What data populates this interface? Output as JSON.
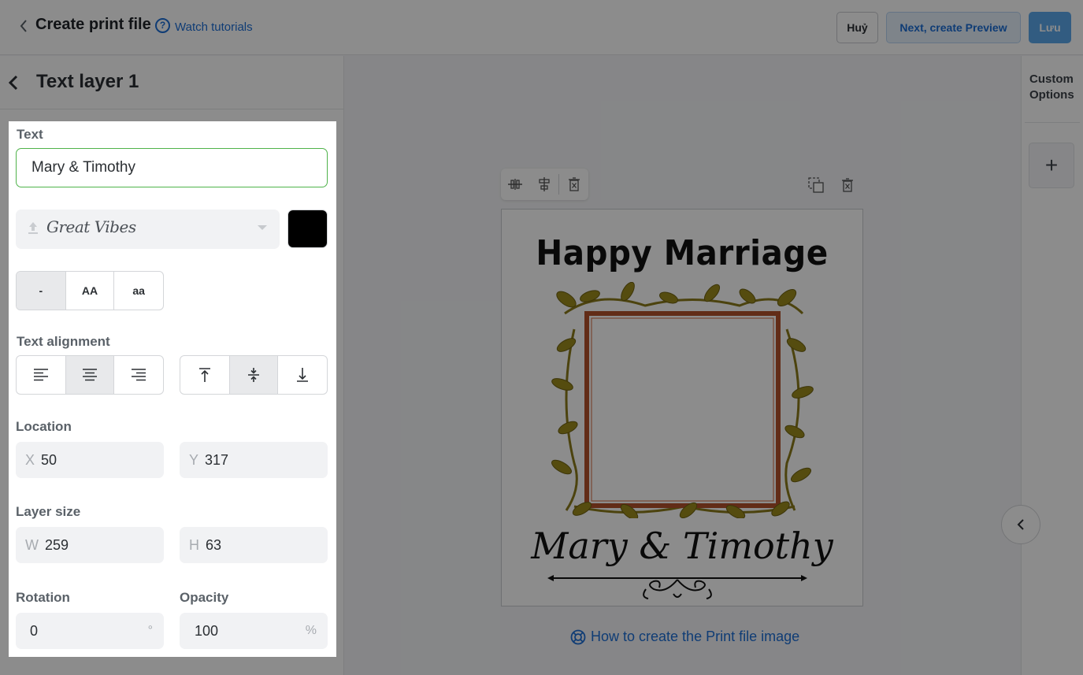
{
  "header": {
    "title": "Create print file",
    "tutorials_link": "Watch tutorials",
    "help_glyph": "?",
    "cancel_label": "Huỷ",
    "next_label": "Next, create Preview",
    "save_label": "Lưu"
  },
  "layer": {
    "title": "Text layer 1",
    "text_label": "Text",
    "text_value": "Mary & Timothy",
    "font_name": "Great Vibes",
    "font_color": "#000000",
    "case_options": [
      "-",
      "AA",
      "aa"
    ],
    "case_selected": "-",
    "alignment_label": "Text alignment",
    "horizontal_alignment_selected": "center",
    "vertical_alignment_selected": "middle",
    "location_label": "Location",
    "x_prefix": "X",
    "x_value": "50",
    "y_prefix": "Y",
    "y_value": "317",
    "size_label": "Layer size",
    "w_prefix": "W",
    "w_value": "259",
    "h_prefix": "H",
    "h_value": "63",
    "rotation_label": "Rotation",
    "rotation_value": "0",
    "rotation_unit": "°",
    "opacity_label": "Opacity",
    "opacity_value": "100",
    "opacity_unit": "%"
  },
  "canvas": {
    "design_title": "Happy Marriage",
    "design_names": "Mary & Timothy",
    "howto_link": "How to create the Print file image"
  },
  "right_panel": {
    "label": "Custom Options",
    "add_glyph": "+"
  },
  "colors": {
    "accent": "#1c6ed6",
    "input_focus_border": "#4fb34a",
    "save_button": "#5ca8eb",
    "frame_wood": "#b3512a",
    "leaf": "#9c8a1d"
  },
  "icons": [
    "back-chevron-icon",
    "help-icon",
    "upload-icon",
    "chevron-down-icon",
    "align-left-icon",
    "align-center-icon",
    "align-right-icon",
    "align-top-icon",
    "align-middle-icon",
    "align-bottom-icon",
    "center-horizontal-icon",
    "center-vertical-icon",
    "delete-icon",
    "duplicate-icon",
    "lifebuoy-icon",
    "plus-icon",
    "chevron-left-icon"
  ]
}
